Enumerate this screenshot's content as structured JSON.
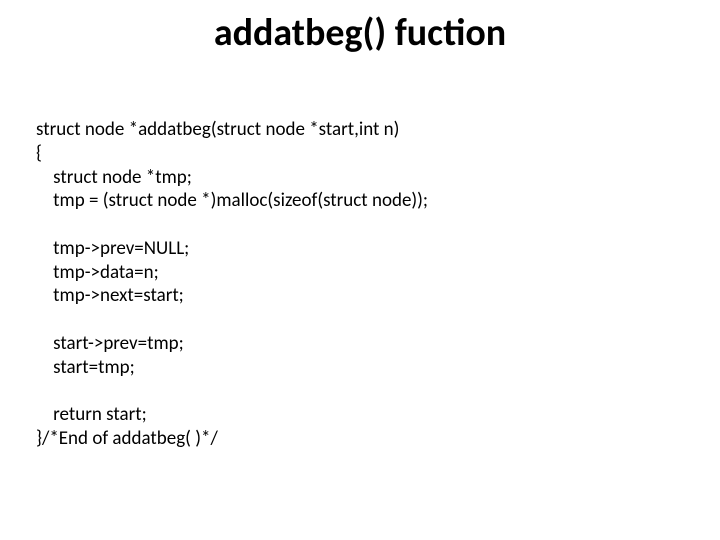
{
  "title": "addatbeg() fuction",
  "code": {
    "l1": "struct node *addatbeg(struct node *start,int n)",
    "l2": "{",
    "l3": "    struct node *tmp;",
    "l4": "    tmp = (struct node *)malloc(sizeof(struct node));",
    "l5": "",
    "l6": "    tmp->prev=NULL;",
    "l7": "    tmp->data=n;",
    "l8": "    tmp->next=start;",
    "l9": "",
    "l10": "    start->prev=tmp;",
    "l11": "    start=tmp;",
    "l12": "",
    "l13": "    return start;",
    "l14": "}/*End of addatbeg( )*/"
  }
}
